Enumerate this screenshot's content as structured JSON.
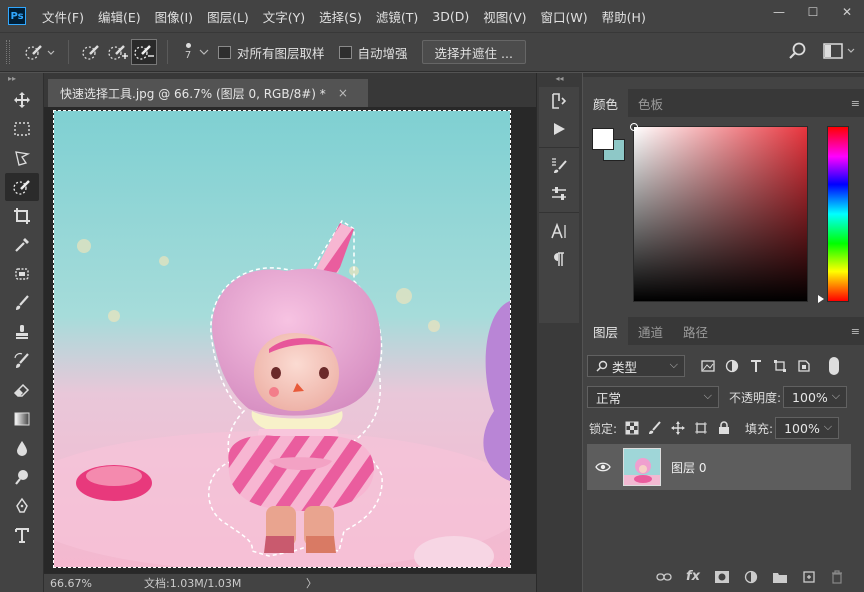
{
  "app": {
    "logo": "Ps"
  },
  "menu": [
    "文件(F)",
    "编辑(E)",
    "图像(I)",
    "图层(L)",
    "文字(Y)",
    "选择(S)",
    "滤镜(T)",
    "3D(D)",
    "视图(V)",
    "窗口(W)",
    "帮助(H)"
  ],
  "window_controls": {
    "minimize": "—",
    "maximize": "☐",
    "close": "✕"
  },
  "options": {
    "brush_size": "7",
    "sample_all_layers": "对所有图层取样",
    "auto_enhance": "自动增强",
    "select_and_mask": "选择并遮住 ..."
  },
  "document": {
    "tab_title": "快速选择工具.jpg @ 66.7% (图层 0, RGB/8#) *",
    "close": "×"
  },
  "status": {
    "zoom": "66.67%",
    "doc_info": "文档:1.03M/1.03M",
    "arrow": "〉"
  },
  "color_panel": {
    "tabs": [
      "颜色",
      "色板"
    ],
    "foreground": "#ffffff",
    "background": "#8ec8c7"
  },
  "layers_panel": {
    "tabs": [
      "图层",
      "通道",
      "路径"
    ],
    "filter_kind": "类型",
    "blend_mode": "正常",
    "opacity_label": "不透明度:",
    "opacity_value": "100%",
    "lock_label": "锁定:",
    "fill_label": "填充:",
    "fill_value": "100%",
    "layer_name": "图层 0"
  },
  "colors": {
    "menubar_bg": "#434343",
    "panel_bg": "#434343",
    "canvas_bg": "#282828",
    "active_layer_bg": "#5d5d5d"
  }
}
